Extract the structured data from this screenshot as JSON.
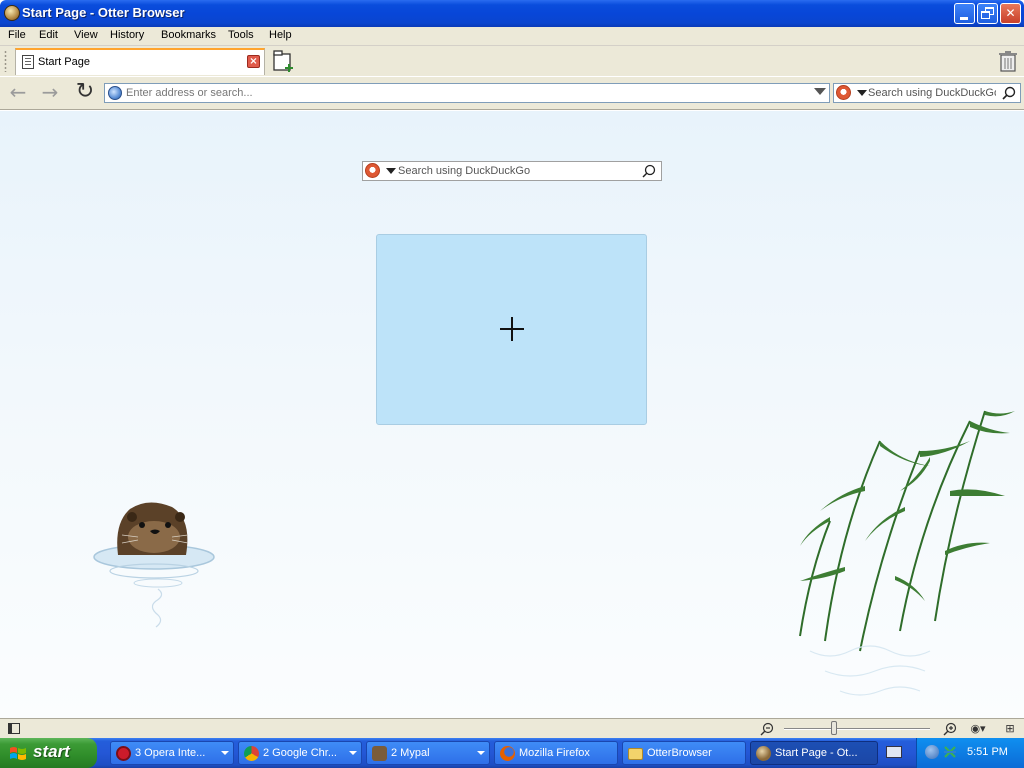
{
  "window": {
    "title": "Start Page - Otter Browser",
    "buttons": [
      "minimize",
      "maximize",
      "close"
    ]
  },
  "menubar": {
    "items": [
      "File",
      "Edit",
      "View",
      "History",
      "Bookmarks",
      "Tools",
      "Help"
    ]
  },
  "tabs": [
    {
      "label": "Start Page",
      "icon": "document-icon",
      "active": true
    }
  ],
  "toolbar": {
    "address_placeholder": "Enter address or search...",
    "search_placeholder": "Search using DuckDuckGo"
  },
  "content": {
    "search_placeholder": "Search using DuckDuckGo",
    "speed_dial_add": "add-speed-dial"
  },
  "taskbar": {
    "start_label": "start",
    "tasks": [
      {
        "label": "3 Opera Inte...",
        "icon": "opera-icon",
        "color": "#cc1b2a",
        "grouped": true
      },
      {
        "label": "2 Google Chr...",
        "icon": "chrome-icon",
        "color": "#4caf50",
        "grouped": true
      },
      {
        "label": "2 Mypal",
        "icon": "mypal-icon",
        "color": "#7a5c3a",
        "grouped": true
      },
      {
        "label": "Mozilla Firefox",
        "icon": "firefox-icon",
        "color": "#e66000",
        "grouped": false
      },
      {
        "label": "OtterBrowser",
        "icon": "folder-icon",
        "color": "#f3d36b",
        "grouped": false
      },
      {
        "label": "Start Page - Ot...",
        "icon": "otter-icon",
        "color": "#8b6a3a",
        "grouped": false,
        "active": true
      }
    ],
    "clock": "5:51 PM"
  },
  "colors": {
    "titlebar": "#0a4ddc",
    "tab_accent": "#ffa42e",
    "speed_dial": "#bde3f9",
    "taskbar": "#245edb",
    "start": "#3c9b36"
  }
}
